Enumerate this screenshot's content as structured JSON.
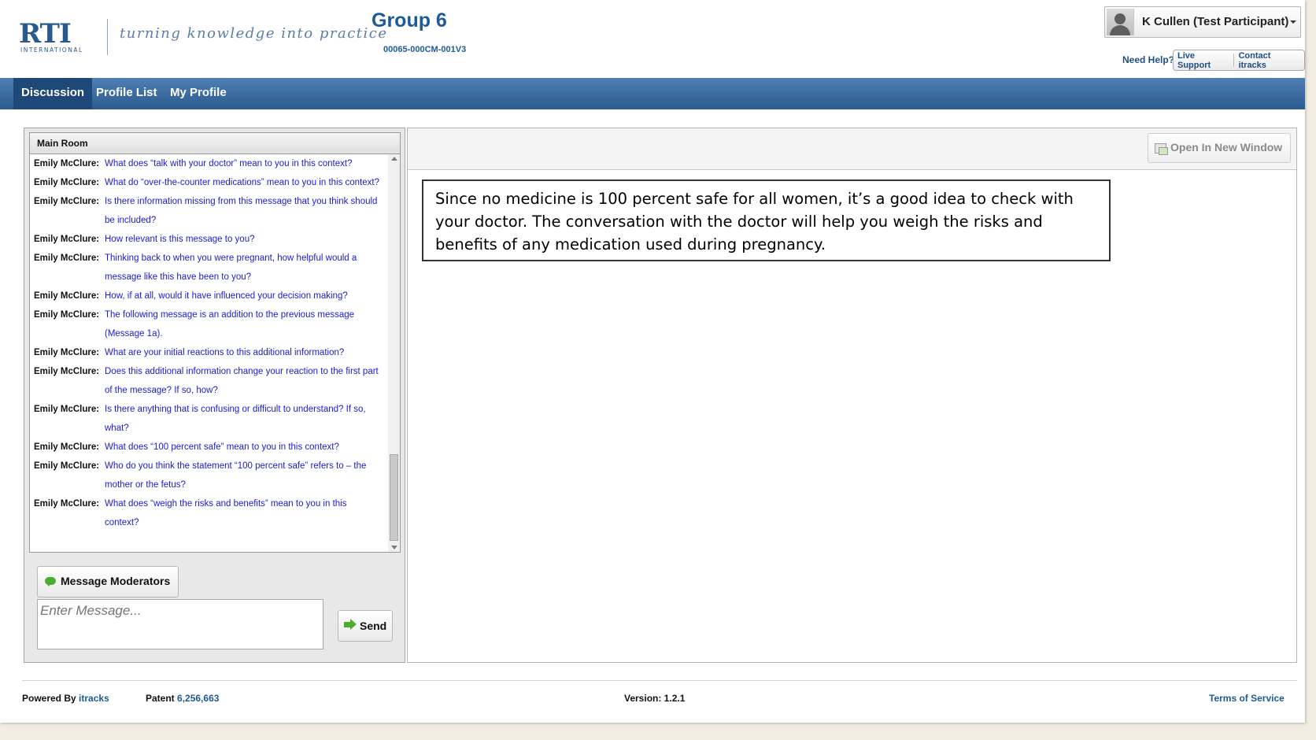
{
  "header": {
    "logo_text": "RTI",
    "logo_subtext": "INTERNATIONAL",
    "tagline": "turning knowledge into practice",
    "group_title": "Group 6",
    "group_code": "00065-000CM-001V3",
    "user_name": "K Cullen (Test Participant)",
    "need_help": "Need Help?",
    "live_support": "Live Support",
    "contact": "Contact itracks"
  },
  "nav": {
    "items": [
      "Discussion",
      "Profile List",
      "My Profile"
    ]
  },
  "chat": {
    "room_title": "Main Room",
    "messages": [
      {
        "author": "Emily McClure:",
        "text": "What does “talk with your doctor” mean to you in this context?"
      },
      {
        "author": "Emily McClure:",
        "text": "What do “over-the-counter medications” mean to you in this context?"
      },
      {
        "author": "Emily McClure:",
        "text": "Is there information missing from this message that you think should be included?"
      },
      {
        "author": "Emily McClure:",
        "text": "How relevant is this message to you?"
      },
      {
        "author": "Emily McClure:",
        "text": "Thinking back to when you were pregnant, how helpful would a message like this have been to you?"
      },
      {
        "author": "Emily McClure:",
        "text": "How, if at all, would it have influenced your decision making?"
      },
      {
        "author": "Emily McClure:",
        "text": "The following message is an addition to the previous message (Message 1a)."
      },
      {
        "author": "Emily McClure:",
        "text": "What are your initial reactions to this additional information?"
      },
      {
        "author": "Emily McClure:",
        "text": "Does this additional information change your reaction to the first part of the message? If so, how?"
      },
      {
        "author": "Emily McClure:",
        "text": "Is there anything that is confusing or difficult to understand? If so, what?"
      },
      {
        "author": "Emily McClure:",
        "text": "What does “100 percent safe” mean to you in this context?"
      },
      {
        "author": "Emily McClure:",
        "text": "Who do you think the statement “100 percent safe” refers to – the mother or the fetus?"
      },
      {
        "author": "Emily McClure:",
        "text": "What does “weigh the risks and benefits” mean to you in this context?"
      }
    ],
    "message_moderators_label": "Message Moderators",
    "input_placeholder": "Enter Message...",
    "send_label": "Send"
  },
  "stimulus": {
    "open_new_window_label": "Open In New Window",
    "text": "Since no medicine is 100 percent safe for all women, it’s a good idea to check with your doctor. The conversation with the doctor will help you weigh the risks and benefits of any medication used during pregnancy."
  },
  "footer": {
    "powered_by": "Powered By",
    "powered_link": "itracks",
    "patent_label": "Patent",
    "patent_number": "6,256,663",
    "version": "Version: 1.2.1",
    "terms": "Terms of Service"
  }
}
